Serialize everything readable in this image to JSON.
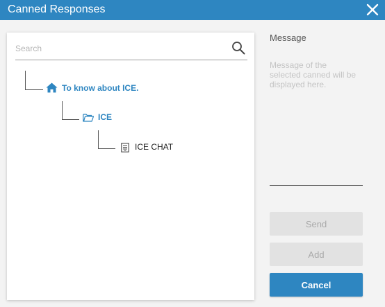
{
  "dialog": {
    "title": "Canned Responses",
    "close_icon": "close-icon",
    "accent_color": "#2e86c1"
  },
  "search": {
    "placeholder": "Search",
    "value": "",
    "icon": "search-icon"
  },
  "tree": {
    "root": {
      "label": "To know about ICE.",
      "icon": "home-icon"
    },
    "folder": {
      "label": "ICE",
      "icon": "folder-open-icon"
    },
    "item": {
      "label": "ICE CHAT",
      "icon": "document-icon"
    }
  },
  "message": {
    "label": "Message",
    "placeholder_text": "Message of the selected canned will be displayed here."
  },
  "buttons": {
    "send": "Send",
    "add": "Add",
    "cancel": "Cancel"
  }
}
